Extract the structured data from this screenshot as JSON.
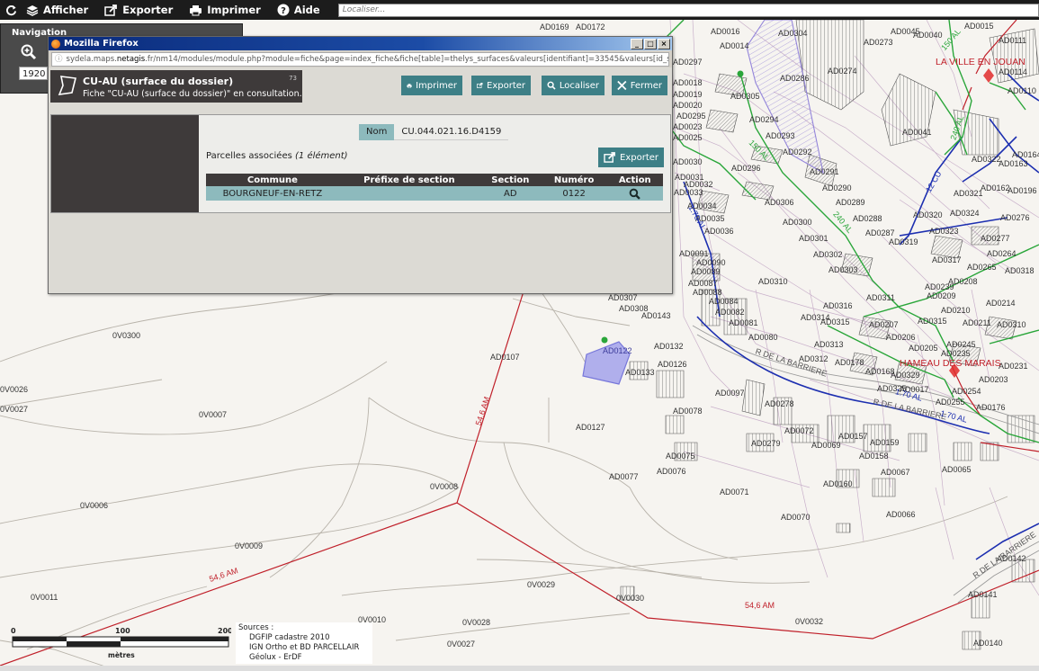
{
  "toolbar": {
    "back_icon": "refresh-icon",
    "afficher": "Afficher",
    "exporter": "Exporter",
    "imprimer": "Imprimer",
    "aide": "Aide",
    "search_placeholder": "Localiser..."
  },
  "nav": {
    "title": "Navigation",
    "scale": "1920"
  },
  "firefox": {
    "title": "Mozilla Firefox",
    "url_prefix": "sydela.maps.",
    "url_domain": "netagis",
    "url_rest": ".fr/nm14/modules/module.php?module=fiche&page=index_fiche&fiche[table]=thelys_surfaces&valeurs[identifiant]=33545&valeurs[id_svg]=the"
  },
  "fiche": {
    "title": "CU-AU (surface du dossier)",
    "subtitle": "Fiche \"CU-AU (surface du dossier)\" en consultation.",
    "badge": "73",
    "btn_imprimer": "Imprimer",
    "btn_exporter": "Exporter",
    "btn_localiser": "Localiser",
    "btn_fermer": "Fermer",
    "nom_label": "Nom",
    "nom_value": "CU.044.021.16.D4159",
    "parcels_label": "Parcelles associées",
    "parcels_count": "(1 élément)",
    "btn_exporter2": "Exporter",
    "table": {
      "headers": [
        "Commune",
        "Préfixe de section",
        "Section",
        "Numéro",
        "Action"
      ],
      "rows": [
        {
          "commune": "BOURGNEUF-EN-RETZ",
          "prefixe": "",
          "section": "AD",
          "numero": "0122",
          "action": "search-icon"
        }
      ]
    }
  },
  "map": {
    "places": [
      "LA VILLE EN JOUAN",
      "HAMEAU DES MARAIS"
    ],
    "parcels": [
      "AD0286",
      "AD0274",
      "AD0273",
      "AD0305",
      "AD0294",
      "AD0293",
      "AD0292",
      "AD0296",
      "AD0291",
      "AD0290",
      "AD0289",
      "AD0306",
      "AD0300",
      "AD0288",
      "AD0287",
      "AD0301",
      "AD0302",
      "AD0303",
      "AD0310",
      "AD0311",
      "AD0307",
      "AD0308",
      "AD0143",
      "AD0122",
      "AD0132",
      "AD0126",
      "AD0133",
      "AD0107",
      "AD0127",
      "AD0080",
      "AD0312",
      "AD0178",
      "AD0313",
      "AD0316",
      "AD0315",
      "AD0314",
      "AD0081",
      "AD0082",
      "AD0084",
      "AD0087",
      "AD0088",
      "AD0089",
      "AD0090",
      "AD0091",
      "AD0034",
      "AD0035",
      "AD0036",
      "AD0033",
      "AD0032",
      "AD0031",
      "AD0030",
      "AD0097",
      "AD0078",
      "AD0278",
      "AD0072",
      "AD0279",
      "AD0069",
      "AD0157",
      "AD0159",
      "AD0158",
      "AD0067",
      "AD0065",
      "AD0075",
      "AD0076",
      "AD0077",
      "AD0071",
      "AD0160",
      "AD0070",
      "AD0066",
      "AD0041",
      "AD0110",
      "AD0114",
      "AD0111",
      "AD0164",
      "AD0163",
      "AD0322",
      "AD0321",
      "AD0162",
      "AD0196",
      "AD0320",
      "AD0324",
      "AD0323",
      "AD0276",
      "AD0277",
      "AD0264",
      "AD0265",
      "AD0318",
      "AD0319",
      "AD0317",
      "AD0239",
      "AD0208",
      "AD0209",
      "AD0210",
      "AD0214",
      "AD0211",
      "AD0310",
      "AD0207",
      "AD0206",
      "AD0205",
      "AD0245",
      "AD0235",
      "AD0231",
      "AD0203",
      "AD0254",
      "AD0255",
      "AD0176",
      "AD0329",
      "AD0168",
      "AD0325",
      "AD0142",
      "AD0141",
      "AD0140",
      "AD0014",
      "AD0016",
      "AD0018",
      "AD0019",
      "AD0020",
      "AD0023",
      "AD0025",
      "AD0295",
      "AD0297",
      "AD0315",
      "AD0040",
      "AD0304",
      "AD0045",
      "AD0172",
      "AD0169",
      "AD0017",
      "AD0015"
    ],
    "sections": [
      "0V0300",
      "0V0026",
      "0V0027",
      "0V0007",
      "0V0008",
      "0V0006",
      "0V0009",
      "0V0011",
      "0V0010",
      "0V0028",
      "0V0027",
      "0V0029",
      "0V0030",
      "0V0032"
    ],
    "roads": [
      "R DE LA BARRIERE",
      "R DE LA BARRIERE",
      "R DE LA BARRIERE"
    ],
    "lines": [
      "54,6 AM",
      "54,6 AM",
      "54,6 AM",
      "150 AL",
      "240 AL",
      "1.70 AL",
      "12 CU",
      "240 AL",
      "150 AL",
      "1.70 AL",
      "1.70 AL"
    ]
  },
  "sources": {
    "heading": "Sources :",
    "items": [
      "DGFIP cadastre 2010",
      "IGN Ortho et BD PARCELLAIR",
      "Géolux - ErDF"
    ]
  },
  "scalebar": {
    "ticks": [
      "0",
      "100",
      "200"
    ],
    "unit": "mètres"
  }
}
